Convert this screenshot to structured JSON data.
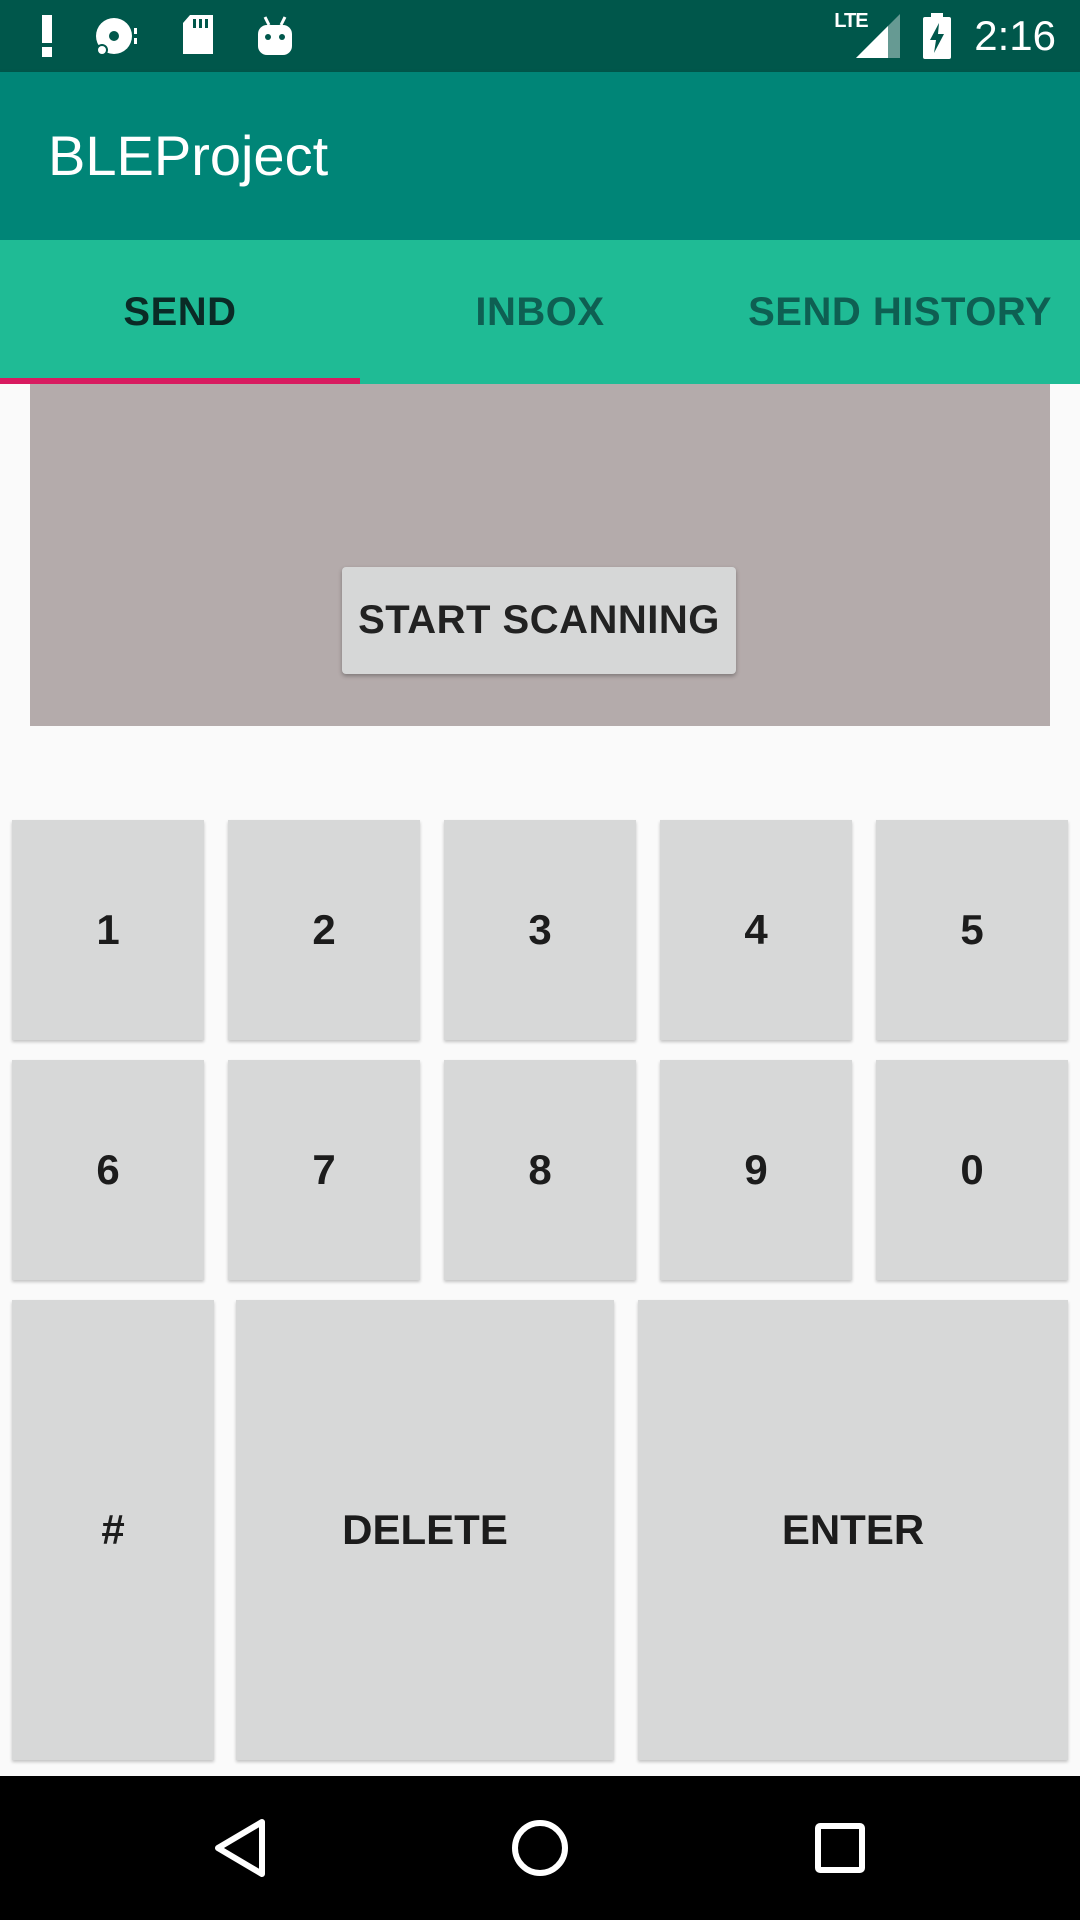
{
  "status_bar": {
    "time": "2:16",
    "network_label": "LTE",
    "icons": [
      "alert-icon",
      "disk-icon",
      "sd-card-icon",
      "android-icon",
      "signal-icon",
      "battery-charging-icon"
    ]
  },
  "app_bar": {
    "title": "BLEProject"
  },
  "tabs": [
    {
      "label": "SEND",
      "active": true
    },
    {
      "label": "INBOX",
      "active": false
    },
    {
      "label": "SEND HISTORY",
      "active": false
    }
  ],
  "scan": {
    "button_label": "START SCANNING"
  },
  "keypad": {
    "row1": [
      "1",
      "2",
      "3",
      "4",
      "5"
    ],
    "row2": [
      "6",
      "7",
      "8",
      "9",
      "0"
    ],
    "row3": [
      "#",
      "DELETE",
      "ENTER"
    ]
  },
  "nav_bar": {
    "icons": [
      "back-icon",
      "home-icon",
      "recents-icon"
    ]
  },
  "colors": {
    "status_bar": "#00574b",
    "app_bar": "#008577",
    "tab_bar": "#1fbb95",
    "tab_indicator": "#d81b60",
    "scan_panel": "#b4abab",
    "key": "#d7d8d8"
  }
}
